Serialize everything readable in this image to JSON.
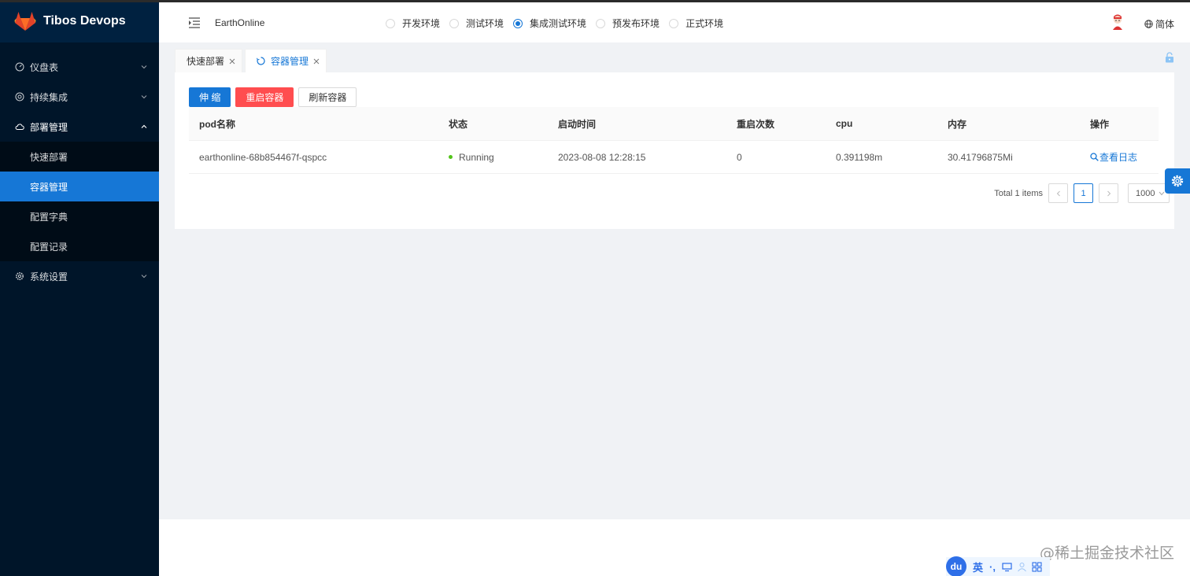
{
  "app": {
    "title": "Tibos Devops"
  },
  "sidebar": {
    "items": [
      {
        "label": "仪盘表",
        "icon": "dashboard-icon"
      },
      {
        "label": "持续集成",
        "icon": "ci-icon"
      },
      {
        "label": "部署管理",
        "icon": "cloud-icon",
        "children": [
          {
            "label": "快速部署"
          },
          {
            "label": "容器管理",
            "active": true
          },
          {
            "label": "配置字典"
          },
          {
            "label": "配置记录"
          }
        ]
      },
      {
        "label": "系统设置",
        "icon": "settings-icon"
      }
    ]
  },
  "header": {
    "project": "EarthOnline",
    "envs": [
      {
        "label": "开发环境",
        "checked": false
      },
      {
        "label": "测试环境",
        "checked": false
      },
      {
        "label": "集成测试环境",
        "checked": true
      },
      {
        "label": "预发布环境",
        "checked": false
      },
      {
        "label": "正式环境",
        "checked": false
      }
    ],
    "lang": "简体"
  },
  "tabs": [
    {
      "label": "快速部署",
      "active": false
    },
    {
      "label": "容器管理",
      "active": true
    }
  ],
  "toolbar": {
    "scale": "伸 缩",
    "restart": "重启容器",
    "refresh": "刷新容器"
  },
  "table": {
    "columns": [
      "pod名称",
      "状态",
      "启动时间",
      "重启次数",
      "cpu",
      "内存",
      "操作"
    ],
    "rows": [
      {
        "name": "earthonline-68b854467f-qspcc",
        "status": "Running",
        "start_time": "2023-08-08 12:28:15",
        "restarts": "0",
        "cpu": "0.391198m",
        "memory": "30.41796875Mi",
        "action": "查看日志"
      }
    ]
  },
  "pagination": {
    "total": "Total 1 items",
    "current": "1",
    "page_size": "1000"
  },
  "footer": {
    "watermark": "@稀土掘金技术社区",
    "ime": {
      "logo": "du",
      "mode": "英",
      "punct": "·,"
    }
  },
  "colors": {
    "primary": "#1677d6",
    "danger": "#ff4d4f",
    "sidebar": "#001529",
    "running": "#52c41a"
  }
}
